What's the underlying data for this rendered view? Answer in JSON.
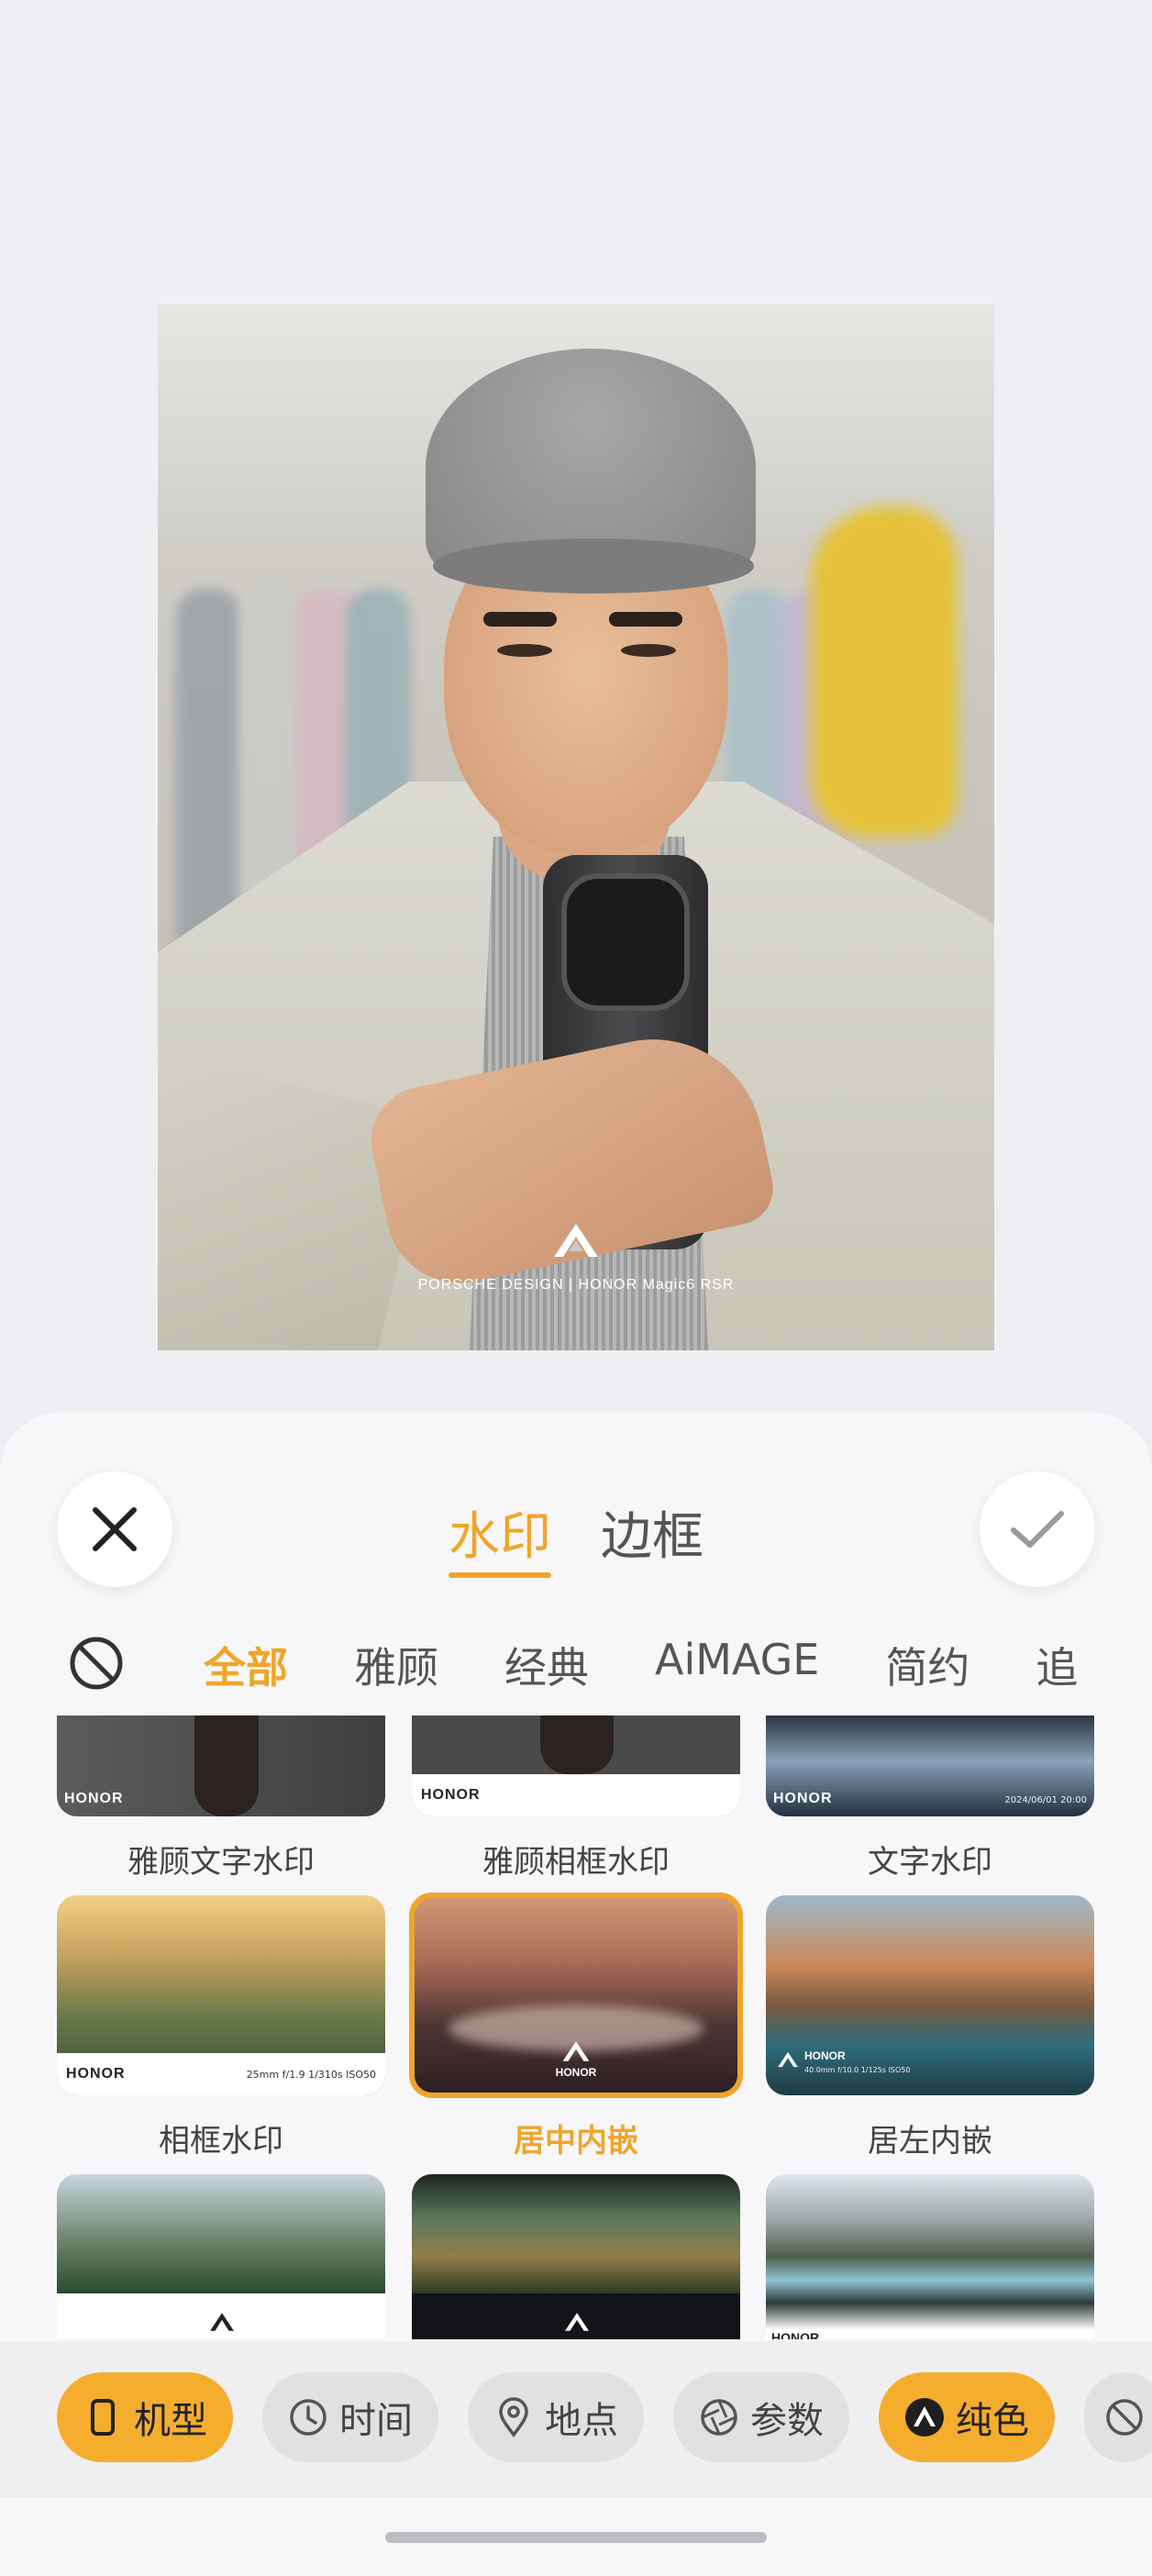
{
  "preview": {
    "watermark_text": "PORSCHE DESIGN | HONOR Magic6 RSR"
  },
  "header": {
    "tabs": [
      {
        "label": "水印",
        "active": true
      },
      {
        "label": "边框",
        "active": false
      }
    ]
  },
  "categories": {
    "items": [
      "全部",
      "雅顾",
      "经典",
      "AiMAGE",
      "简约",
      "追"
    ],
    "active": "全部"
  },
  "templates": [
    {
      "label": "雅顾文字水印",
      "brand": "HONOR"
    },
    {
      "label": "雅顾相框水印",
      "brand": "HONOR"
    },
    {
      "label": "文字水印",
      "brand": "HONOR",
      "date": "2024/06/01 20:00"
    },
    {
      "label": "相框水印",
      "brand": "HONOR",
      "spec": "25mm  f/1.9  1/310s  ISO50"
    },
    {
      "label": "居中内嵌",
      "brand": "HONOR",
      "selected": true
    },
    {
      "label": "居左内嵌",
      "brand": "HONOR",
      "spec": "40.0mm  f/10.0  1/125s  ISO50"
    },
    {
      "label": "",
      "brand": ""
    },
    {
      "label": "",
      "brand": ""
    },
    {
      "label": "",
      "brand": "HONOR"
    }
  ],
  "chips": [
    {
      "label": "机型",
      "icon": "phone-icon",
      "active": true
    },
    {
      "label": "时间",
      "icon": "clock-icon",
      "active": false
    },
    {
      "label": "地点",
      "icon": "location-pin-icon",
      "active": false
    },
    {
      "label": "参数",
      "icon": "aperture-icon",
      "active": false
    },
    {
      "label": "纯色",
      "icon": "honor-logo-icon",
      "active": true
    },
    {
      "label": "",
      "icon": "none-icon",
      "active": false
    }
  ],
  "colors": {
    "accent": "#f0a52a",
    "chip_active": "#f5ad2e",
    "background": "#efeff3"
  }
}
